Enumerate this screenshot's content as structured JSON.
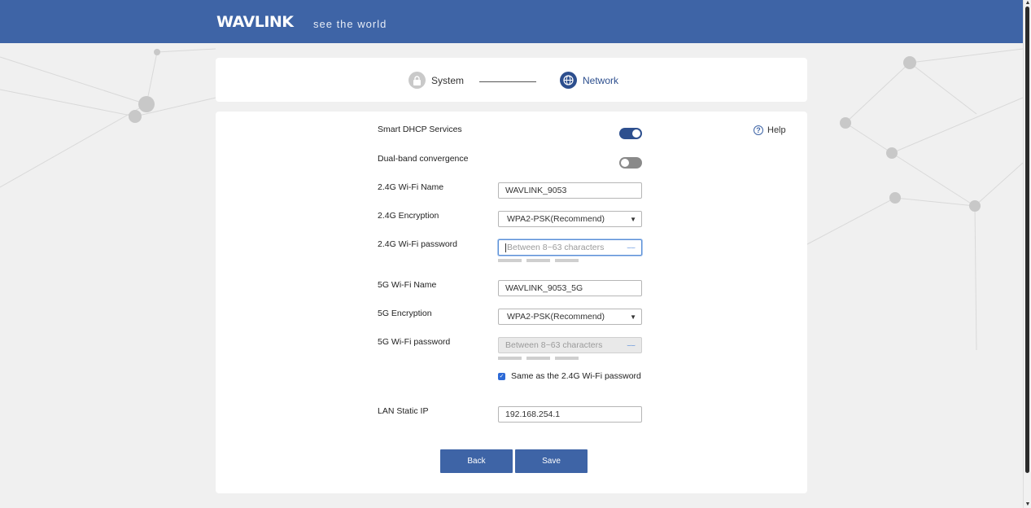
{
  "header": {
    "logo_text": "WAVLINK",
    "tagline": "see the world",
    "bg_color": "#3e64a6"
  },
  "steps": [
    {
      "label": "System",
      "icon": "lock-icon",
      "state": "done"
    },
    {
      "label": "Network",
      "icon": "globe-icon",
      "state": "active"
    }
  ],
  "help": {
    "label": "Help",
    "icon": "question-circle-icon"
  },
  "form": {
    "smart_dhcp": {
      "label": "Smart DHCP Services",
      "enabled": true
    },
    "dual_band": {
      "label": "Dual-band convergence",
      "enabled": false
    },
    "wifi24_name": {
      "label": "2.4G Wi-Fi Name",
      "value": "WAVLINK_9053"
    },
    "wifi24_encryption": {
      "label": "2.4G Encryption",
      "value": "WPA2-PSK(Recommend)"
    },
    "wifi24_password": {
      "label": "2.4G Wi-Fi password",
      "placeholder": "Between 8~63 characters"
    },
    "wifi5_name": {
      "label": "5G Wi-Fi Name",
      "value": "WAVLINK_9053_5G"
    },
    "wifi5_encryption": {
      "label": "5G Encryption",
      "value": "WPA2-PSK(Recommend)"
    },
    "wifi5_password": {
      "label": "5G Wi-Fi password",
      "placeholder": "Between 8~63 characters"
    },
    "same_password": {
      "label": "Same as the 2.4G Wi-Fi password",
      "checked": true
    },
    "lan_ip": {
      "label": "LAN Static IP",
      "value": "192.168.254.1"
    }
  },
  "buttons": {
    "back": "Back",
    "save": "Save"
  },
  "colors": {
    "accent": "#3e64a6",
    "toggle_on": "#2d4f8e",
    "toggle_off": "#8a8a8a"
  }
}
